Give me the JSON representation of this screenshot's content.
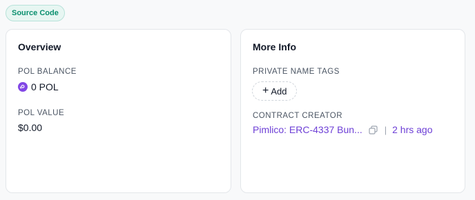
{
  "badge": {
    "label": "Source Code",
    "color": "#0a8f6e"
  },
  "overview": {
    "title": "Overview",
    "balance_label": "POL BALANCE",
    "balance_value": "0 POL",
    "balance_icon": "polygon-token-icon",
    "value_label": "POL VALUE",
    "value_value": "$0.00"
  },
  "more_info": {
    "title": "More Info",
    "tags_label": "PRIVATE NAME TAGS",
    "add_label": "Add",
    "creator_label": "CONTRACT CREATOR",
    "creator_name": "Pimlico: ERC-4337 Bun...",
    "creator_age": "2 hrs ago",
    "copy_icon": "copy-icon"
  },
  "colors": {
    "link": "#6d3fd6",
    "polygon": "#8247e5"
  }
}
